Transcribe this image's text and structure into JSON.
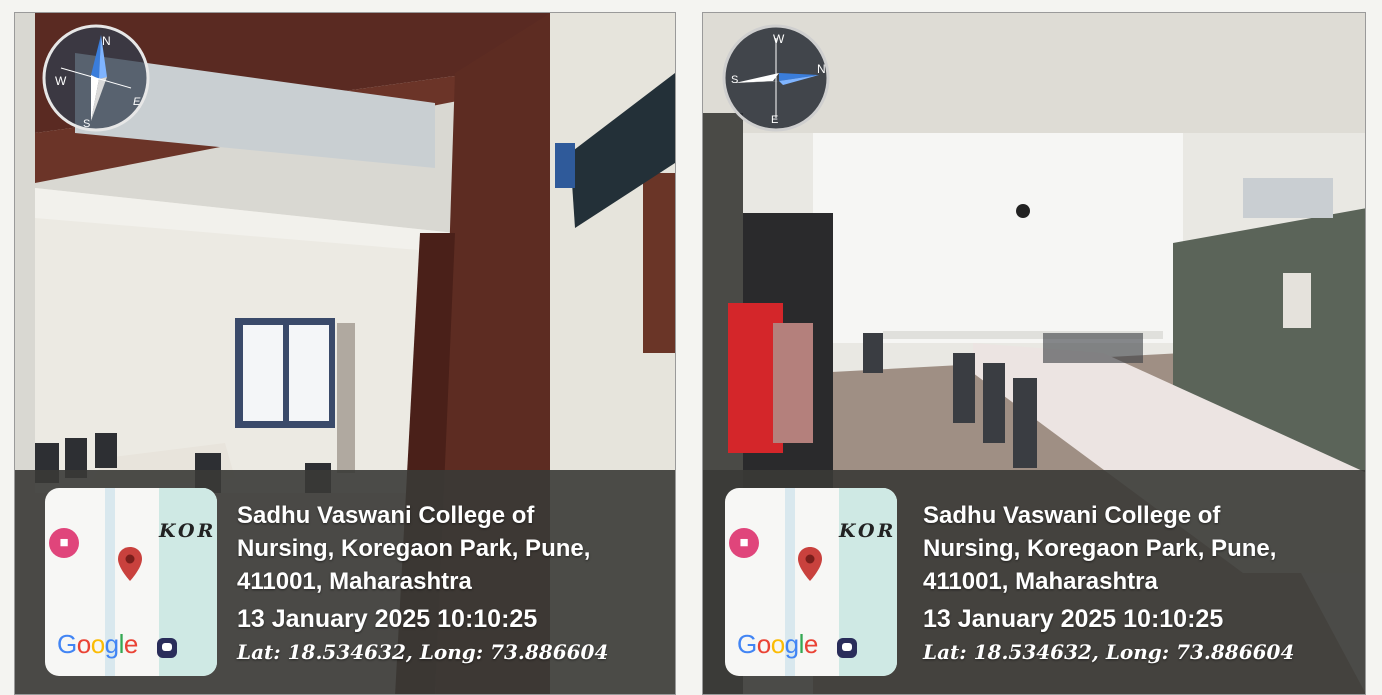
{
  "colors": {
    "overlay": "#3a3a36",
    "map_bg": "#f7f7f5",
    "hotel_marker": "#e0457b",
    "pin": "#c9413d",
    "compass_needle": "#3a7ddb"
  },
  "icons": [
    "compass-icon",
    "hotel-marker-icon",
    "location-pin-icon",
    "google-logo",
    "street-view-icon"
  ],
  "photos": [
    {
      "compass": {
        "n": "N",
        "e": "E",
        "s": "S",
        "w": "W"
      },
      "map": {
        "label": "KOR",
        "brand": "Google"
      },
      "address": "Sadhu Vaswani College of\nNursing, Koregaon Park, Pune,\n411001, Maharashtra",
      "datetime": "13 January 2025 10:10:25",
      "coords": "Lat: 18.534632, Long: 73.886604"
    },
    {
      "compass": {
        "n": "N",
        "e": "E",
        "s": "S",
        "w": "W"
      },
      "map": {
        "label": "KOR",
        "brand": "Google"
      },
      "address": "Sadhu Vaswani College of\nNursing, Koregaon Park, Pune,\n411001, Maharashtra",
      "datetime": "13 January 2025 10:10:25",
      "coords": "Lat: 18.534632, Long: 73.886604"
    }
  ]
}
